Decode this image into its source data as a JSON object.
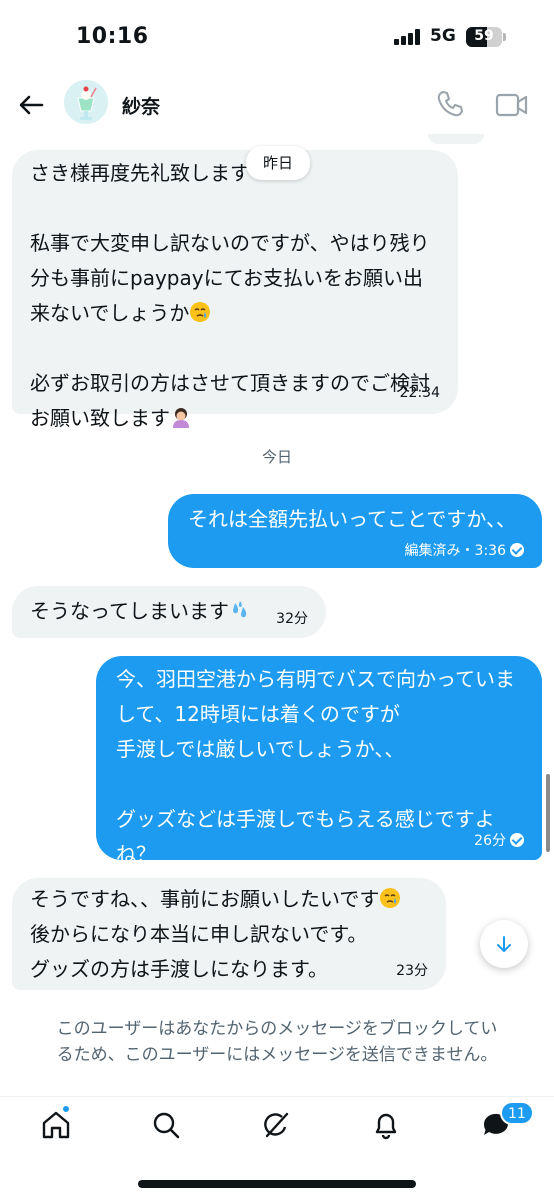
{
  "status_bar": {
    "time": "10:16",
    "network": "5G",
    "battery_level": "59",
    "battery_fraction": 0.59
  },
  "header": {
    "contact_name": "紗奈",
    "back_icon": "back-arrow-icon",
    "phone_icon": "phone-icon",
    "video_icon": "video-camera-icon"
  },
  "chat": {
    "date_pill_yesterday": "昨日",
    "date_today": "今日",
    "messages": [
      {
        "direction": "in",
        "text": "さき様再度先礼致します",
        "text2": "私事で大変申し訳ないのですが、やはり残り\n分も事前にpaypayにてお支払いをお願い出\n来ないでしょうか",
        "text3": "必ずお取引の方はさせて頂きますのでご検討\nお願い致します",
        "time": "22:34"
      },
      {
        "direction": "out",
        "text": "それは全額先払いってことですか、、",
        "status": "編集済み・3:36"
      },
      {
        "direction": "in",
        "text": "そうなってしまいます",
        "time": "32分"
      },
      {
        "direction": "out",
        "text": "今、羽田空港から有明でバスで向かっていま\nして、12時頃には着くのですが\n手渡しでは厳しいでしょうか、、",
        "text2": "グッズなどは手渡しでもらえる感じですよ\nね？",
        "time": "26分"
      },
      {
        "direction": "in",
        "text": "そうですね、、事前にお願いしたいです",
        "text2": "後からになり本当に申し訳ないです。\nグッズの方は手渡しになります。",
        "time": "23分"
      }
    ]
  },
  "blocked_notice": "このユーザーはあなたからのメッセージをブロックしてい\nるため、このユーザーにはメッセージを送信できません。",
  "nav": {
    "items": [
      "home-icon",
      "search-icon",
      "grok-icon",
      "notifications-bell-icon",
      "messages-icon"
    ],
    "messages_badge": "11"
  },
  "colors": {
    "accent": "#1d9bf0",
    "incoming_bubble": "#eff3f4",
    "text": "#0f1419",
    "muted": "#536471"
  }
}
